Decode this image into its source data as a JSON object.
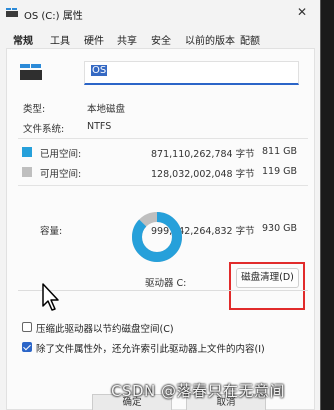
{
  "window": {
    "title": "OS (C:) 属性",
    "close_glyph": "✕"
  },
  "tabs": [
    {
      "label": "常规",
      "active": true
    },
    {
      "label": "工具"
    },
    {
      "label": "硬件"
    },
    {
      "label": "共享"
    },
    {
      "label": "安全"
    },
    {
      "label": "以前的版本"
    },
    {
      "label": "配额"
    }
  ],
  "general": {
    "volume_name": "OS",
    "type_label": "类型:",
    "type_value": "本地磁盘",
    "fs_label": "文件系统:",
    "fs_value": "NTFS"
  },
  "space": {
    "used": {
      "label": "已用空间:",
      "bytes": "871,110,262,784 字节",
      "gb": "811 GB",
      "color": "#26a0da"
    },
    "free": {
      "label": "可用空间:",
      "bytes": "128,032,002,048 字节",
      "gb": "119 GB",
      "color": "#bfbfbf"
    },
    "capacity": {
      "label": "容量:",
      "bytes": "999,142,264,832 字节",
      "gb": "930 GB"
    },
    "used_fraction": 0.8718
  },
  "drive_caption": "驱动器 C:",
  "cleanup_button": "磁盘清理(D)",
  "options": [
    {
      "label": "压缩此驱动器以节约磁盘空间(C)",
      "checked": false
    },
    {
      "label": "除了文件属性外，还允许索引此驱动器上文件的内容(I)",
      "checked": true
    }
  ],
  "buttons": {
    "ok": "确定",
    "cancel": "取消"
  },
  "watermark": "CSDN @落春只在无意间",
  "icons": {
    "drive": "drive-icon",
    "cursor": "mouse-cursor-icon",
    "close": "close-icon"
  },
  "colors": {
    "accent": "#2b65c8",
    "highlight": "#e12b2b"
  }
}
